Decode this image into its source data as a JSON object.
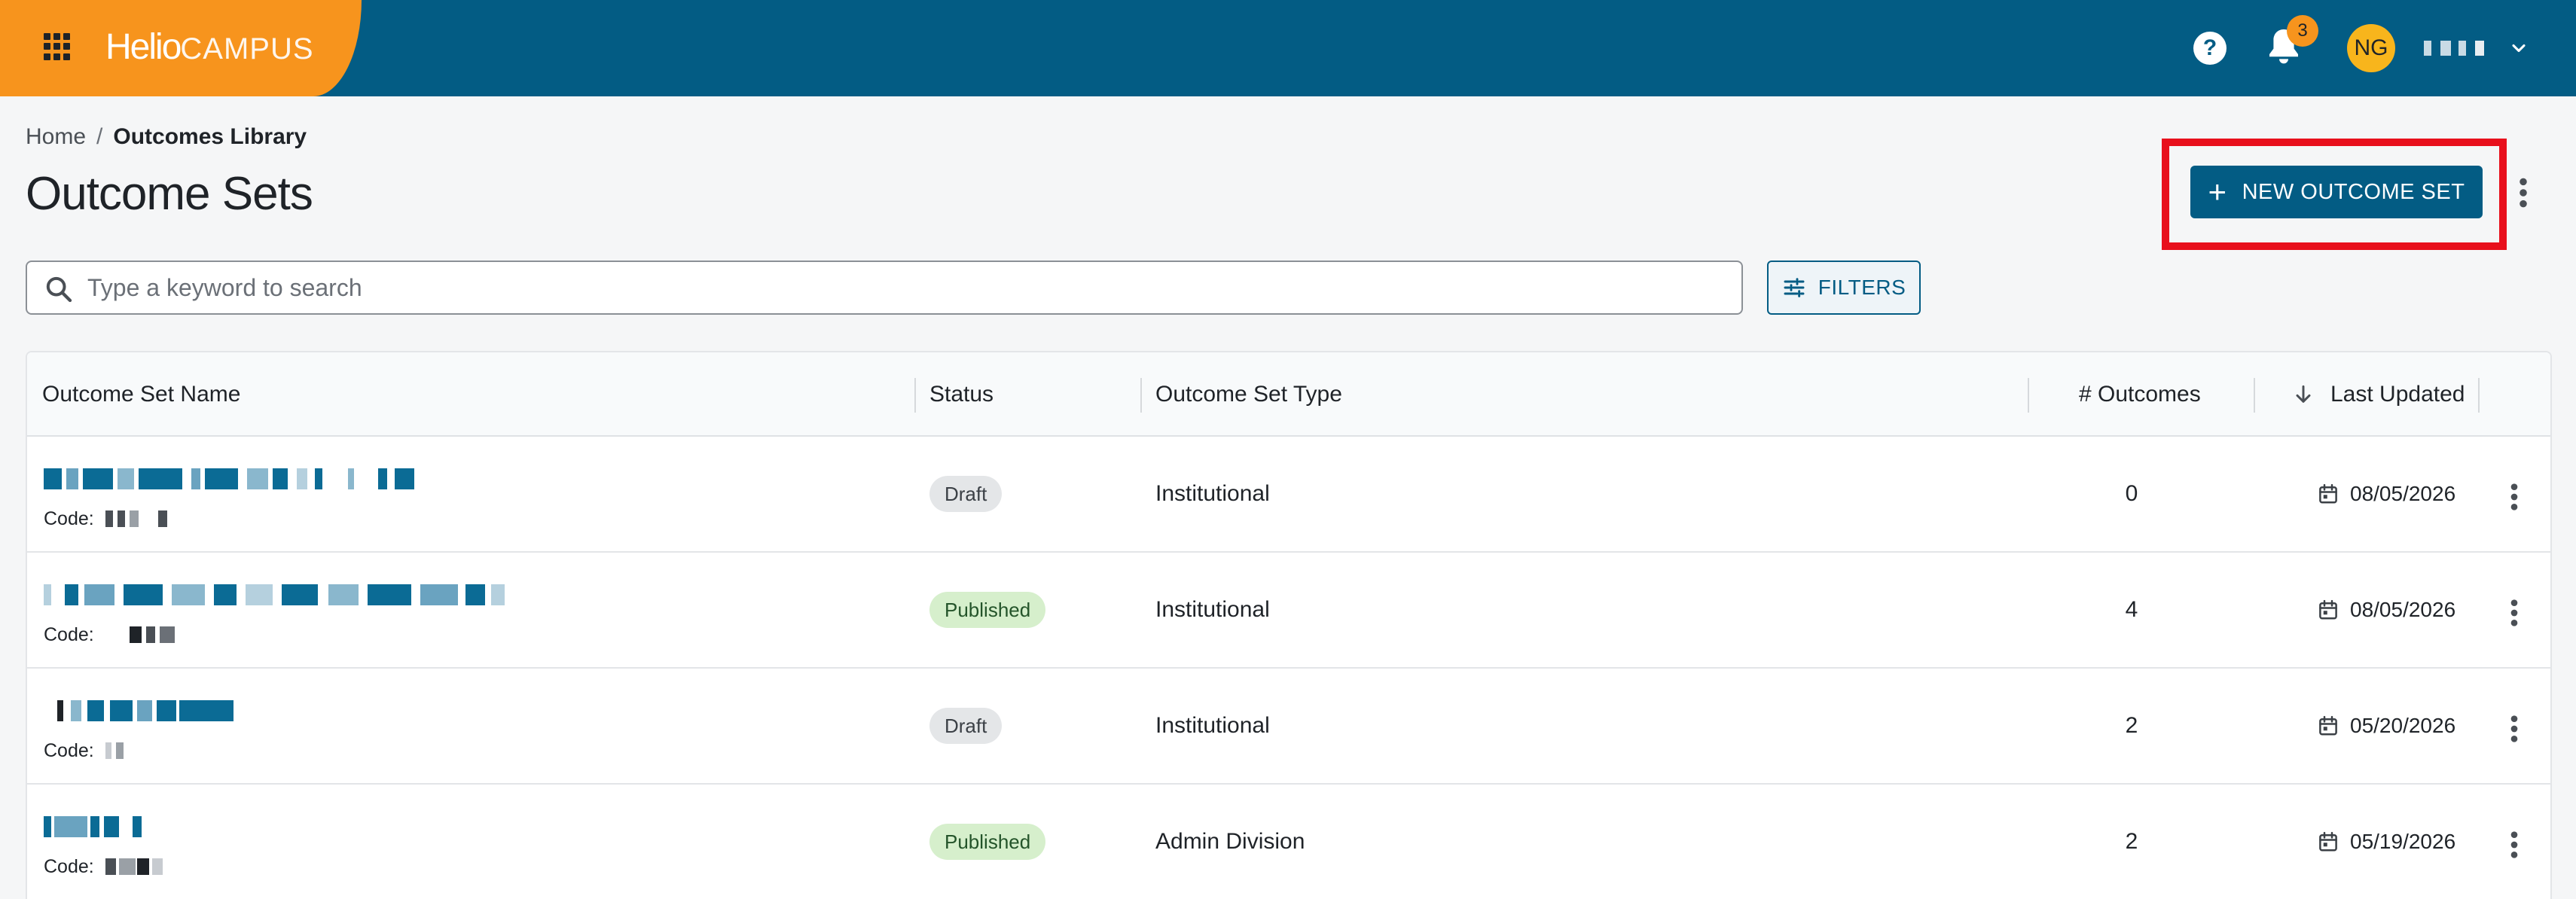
{
  "header": {
    "brand_name": "Helio",
    "brand_suffix": "CAMPUS",
    "notification_count": "3",
    "user_initials": "NG",
    "colors": {
      "bar": "#035c84",
      "brand": "#f7941d",
      "avatar": "#f8b51c"
    }
  },
  "breadcrumb": {
    "home": "Home",
    "separator": "/",
    "current": "Outcomes Library"
  },
  "page": {
    "title": "Outcome Sets",
    "new_button_label": "NEW OUTCOME SET"
  },
  "search": {
    "placeholder": "Type a keyword to search",
    "filters_label": "FILTERS"
  },
  "table": {
    "columns": {
      "name": "Outcome Set Name",
      "status": "Status",
      "type": "Outcome Set Type",
      "outcomes": "# Outcomes",
      "updated": "Last Updated"
    },
    "code_label": "Code:",
    "rows": [
      {
        "status": "Draft",
        "type": "Institutional",
        "outcomes": "0",
        "updated": "08/05/2026"
      },
      {
        "status": "Published",
        "type": "Institutional",
        "outcomes": "4",
        "updated": "08/05/2026"
      },
      {
        "status": "Draft",
        "type": "Institutional",
        "outcomes": "2",
        "updated": "05/20/2026"
      },
      {
        "status": "Published",
        "type": "Admin Division",
        "outcomes": "2",
        "updated": "05/19/2026"
      }
    ]
  }
}
